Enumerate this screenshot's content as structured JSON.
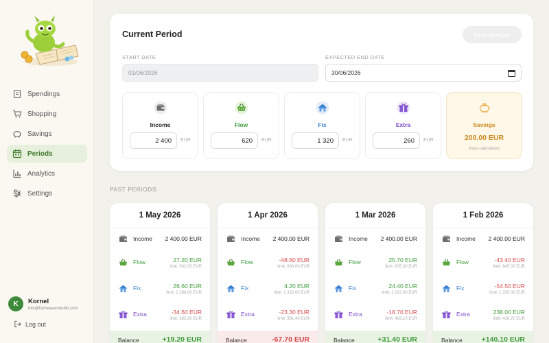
{
  "sidebar": {
    "items": [
      {
        "label": "Spendings",
        "icon": "receipt-icon"
      },
      {
        "label": "Shopping",
        "icon": "cart-icon"
      },
      {
        "label": "Savings",
        "icon": "piggy-bank-icon"
      },
      {
        "label": "Periods",
        "icon": "calendar-icon",
        "active": true
      },
      {
        "label": "Analytics",
        "icon": "bar-chart-icon"
      },
      {
        "label": "Settings",
        "icon": "sliders-icon"
      }
    ],
    "user": {
      "initial": "K",
      "name": "Kornel",
      "email": "info@foxheavenstudio.com"
    },
    "logout_label": "Log out"
  },
  "current": {
    "title": "Current Period",
    "save_label": "Save changes",
    "start_label": "START DATE",
    "start_value": "01/06/2026",
    "end_label": "EXPECTED END DATE",
    "end_value": "30/06/2026",
    "unit": "EUR",
    "categories": [
      {
        "name": "Income",
        "value": "2 400",
        "icon": "wallet-icon"
      },
      {
        "name": "Flow",
        "value": "620",
        "icon": "basket-icon"
      },
      {
        "name": "Fix",
        "value": "1 320",
        "icon": "house-icon"
      },
      {
        "name": "Extra",
        "value": "260",
        "icon": "gift-icon"
      }
    ],
    "savings": {
      "name": "Savings",
      "amount": "200.00 EUR",
      "note": "Auto-calculated",
      "icon": "piggy-bank-icon"
    }
  },
  "past_title": "PAST PERIODS",
  "labels": {
    "income": "Income",
    "flow": "Flow",
    "fix": "Fix",
    "extra": "Extra",
    "balance": "Balance"
  },
  "past": [
    {
      "date": "1 May 2026",
      "income": "2 400.00 EUR",
      "flow": "27.20 EUR",
      "flow_limit": "limit: 562.00 EUR",
      "fix": "26.60 EUR",
      "fix_limit": "limit: 1 298.00 EUR",
      "extra": "-34.60 EUR",
      "extra_limit": "limit: 382.30 EUR",
      "balance": "+19.20 EUR"
    },
    {
      "date": "1 Apr 2026",
      "income": "2 400.00 EUR",
      "flow": "-48.60 EUR",
      "flow_limit": "limit: 680.00 EUR",
      "fix": "4.20 EUR",
      "fix_limit": "limit: 1 320.00 EUR",
      "extra": "-23.30 EUR",
      "extra_limit": "limit: 381.40 EUR",
      "balance": "-67.70 EUR"
    },
    {
      "date": "1 Mar 2026",
      "income": "2 400.00 EUR",
      "flow": "25.70 EUR",
      "flow_limit": "limit: 635.00 EUR",
      "fix": "24.40 EUR",
      "fix_limit": "limit: 1 312.00 EUR",
      "extra": "-18.70 EUR",
      "extra_limit": "limit: 493.10 EUR",
      "balance": "+31.40 EUR"
    },
    {
      "date": "1 Feb 2026",
      "income": "2 400.00 EUR",
      "flow": "-43.40 EUR",
      "flow_limit": "limit: 645.00 EUR",
      "fix": "-54.50 EUR",
      "fix_limit": "limit: 1 335.00 EUR",
      "extra": "238.00 EUR",
      "extra_limit": "limit: 428.20 EUR",
      "balance": "+140.10 EUR"
    }
  ],
  "colors": {
    "accent": "#3f7a2b",
    "positive": "#3f9a3a",
    "negative": "#d64a4a",
    "savings": "#c98a1e",
    "fix": "#3b7fd0",
    "extra": "#7a48c8"
  }
}
